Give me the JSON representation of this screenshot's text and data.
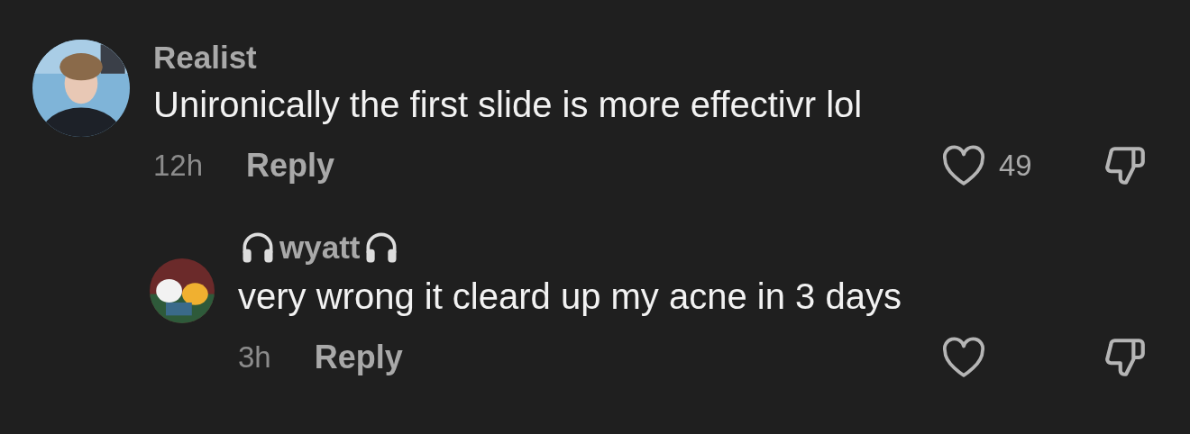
{
  "comments": [
    {
      "author": "Realist",
      "text": "Unironically the first slide is more effectivr lol",
      "time": "12h",
      "reply": "Reply",
      "likes": "49",
      "liked": false,
      "headphones": false,
      "is_reply": false
    },
    {
      "author": "wyatt",
      "text": "very wrong it cleard up my acne in 3 days",
      "time": "3h",
      "reply": "Reply",
      "liked": false,
      "headphones": true,
      "is_reply": true
    }
  ]
}
